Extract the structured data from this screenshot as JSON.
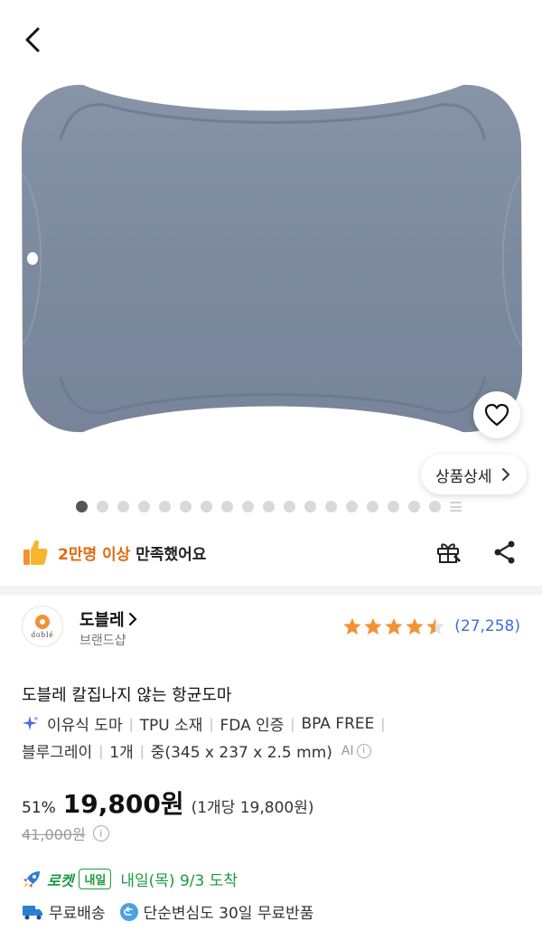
{
  "product_image": {
    "alt": ""
  },
  "gallery": {
    "detail_button_label": "상품상세",
    "total_dots": 19,
    "active_index": 0
  },
  "satisfaction": {
    "highlight": "2만명 이상",
    "rest": "만족했어요"
  },
  "brand": {
    "name": "도블레",
    "subtitle": "브랜드샵",
    "logo_text": "doblé"
  },
  "rating": {
    "stars": 4.5,
    "count": "(27,258)"
  },
  "product": {
    "title": "도블레 칼집나지 않는 항균도마",
    "specs_line1": [
      "이유식 도마",
      "TPU 소재",
      "FDA 인증",
      "BPA FREE"
    ],
    "specs_line2": [
      "블루그레이",
      "1개",
      "중(345 x 237 x 2.5 mm)"
    ],
    "ai_label": "AI"
  },
  "price": {
    "discount": "51%",
    "sale": "19,800원",
    "unit": "(1개당 19,800원)",
    "original": "41,000원"
  },
  "delivery": {
    "rocket_label": "로켓",
    "tomorrow_badge": "내일",
    "arrival": "내일(목) 9/3 도착",
    "free_shipping": "무료배송",
    "free_return": "단순변심도 30일 무료반품"
  },
  "colors": {
    "board": "#7f8ca0",
    "rocket_green": "#1c9a3c",
    "highlight_orange": "#e06a12",
    "rating_blue": "#3a6fd8",
    "star": "#f29235"
  }
}
